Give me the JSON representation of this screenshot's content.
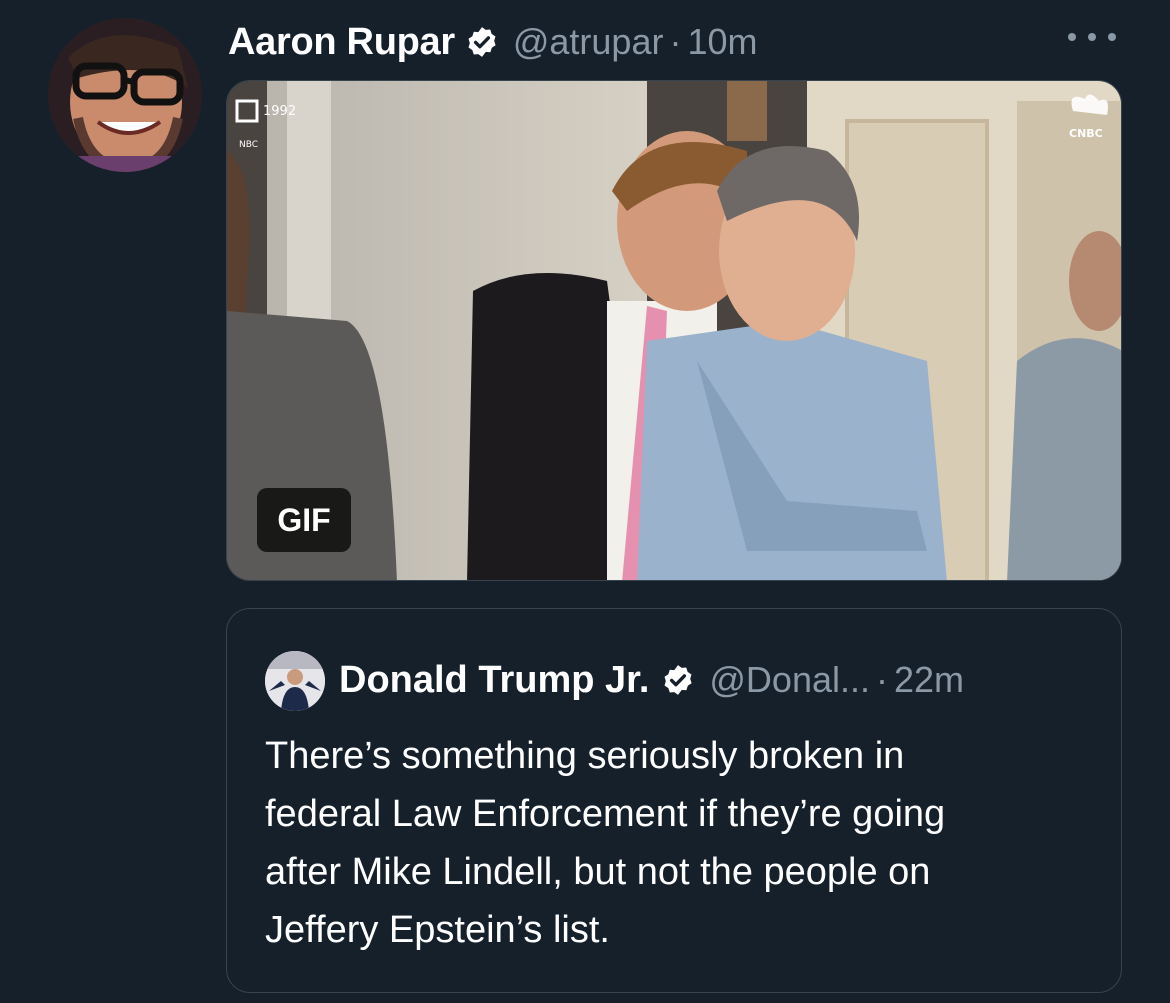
{
  "tweet": {
    "author_name": "Aaron Rupar",
    "handle": "@atrupar",
    "separator": "·",
    "time": "10m",
    "avatar_icon": "user-avatar-photo",
    "verified_icon": "verified-badge-icon",
    "more_icon": "more-options-icon"
  },
  "media": {
    "badge": "GIF",
    "overlay_year": "1992",
    "overlay_network": "NBC",
    "overlay_logo_text": "CNBC"
  },
  "quote": {
    "author_name": "Donald Trump Jr.",
    "handle": "@Donal...",
    "separator": "·",
    "time": "22m",
    "text": "There’s something seriously broken in\nfederal Law Enforcement if they’re going\nafter Mike Lindell, but not the people on\nJeffery Epstein’s list."
  },
  "colors": {
    "background": "#15202b",
    "secondary_text": "#8b98a5",
    "border": "#38444d",
    "verified": "#ffffff"
  }
}
